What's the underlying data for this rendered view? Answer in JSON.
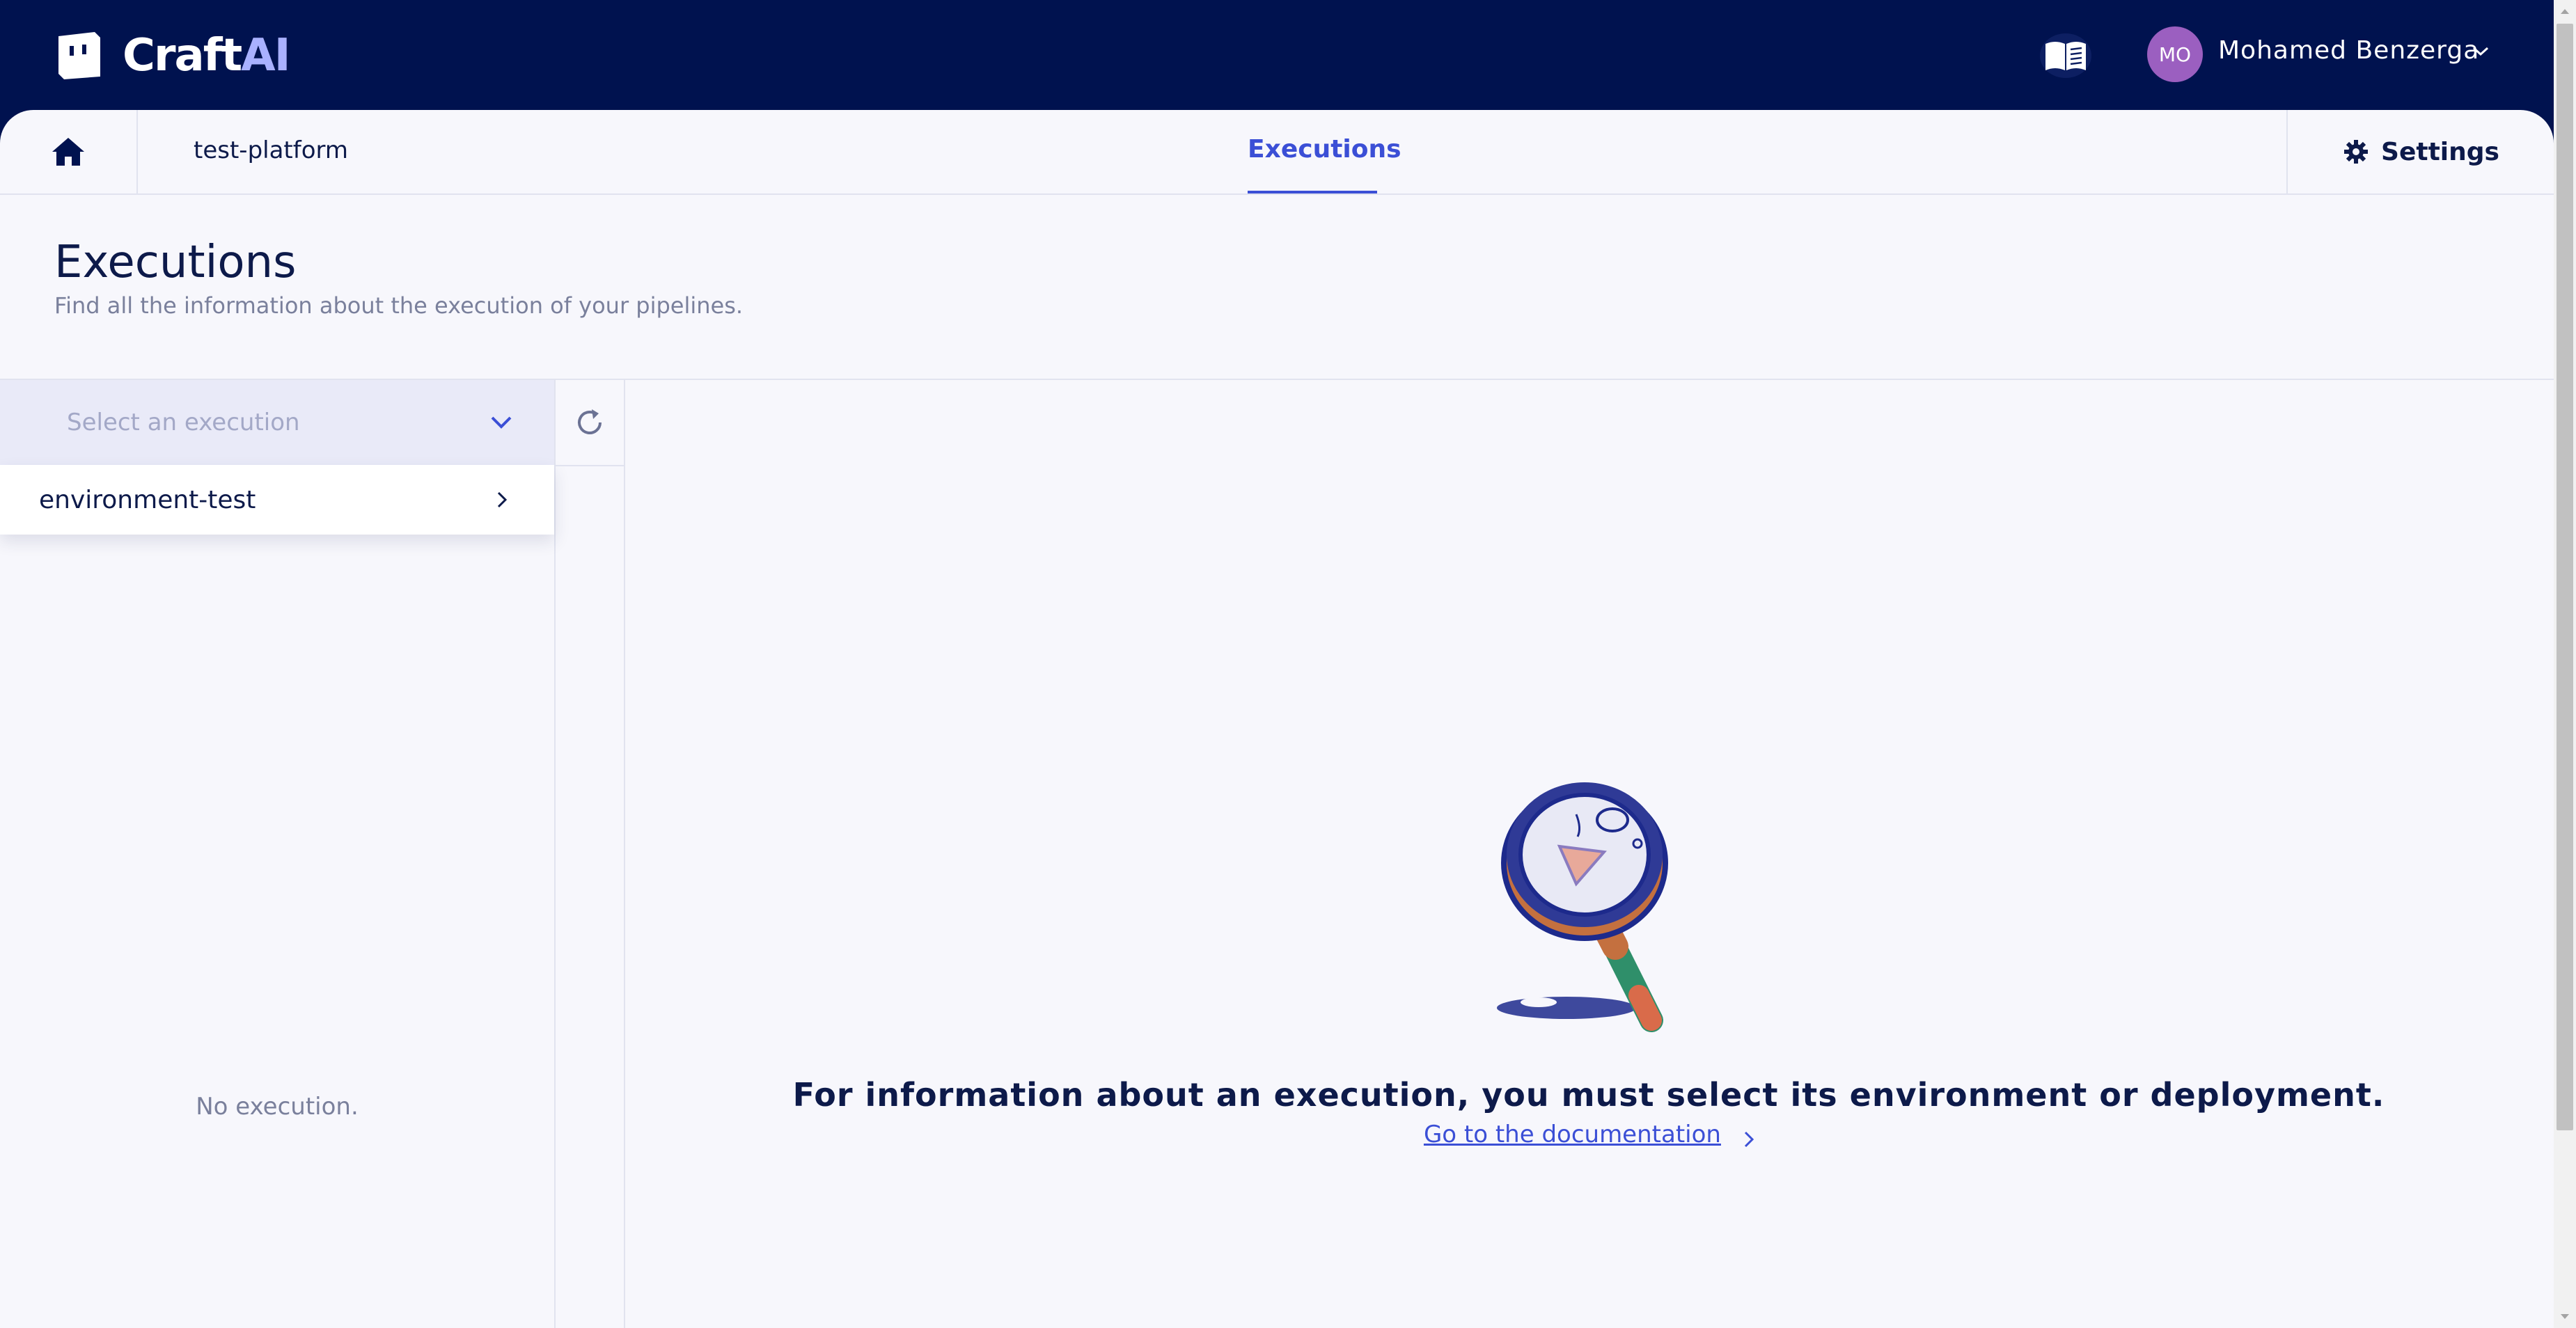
{
  "header": {
    "brand": {
      "name": "Craft",
      "suffix": "AI"
    },
    "user": {
      "initials": "MO",
      "name": "Mohamed Benzerga"
    },
    "icons": {
      "docs": "book-open-icon",
      "user_menu": "chevron-down-icon"
    }
  },
  "nav": {
    "project": "test-platform",
    "active_tab": "Executions",
    "settings_label": "Settings",
    "icons": {
      "home": "home-icon",
      "settings": "gear-icon"
    }
  },
  "page": {
    "title": "Executions",
    "subtitle": "Find all the information about the execution of your pipelines."
  },
  "execution_panel": {
    "select_placeholder": "Select an execution",
    "dropdown_items": [
      {
        "label": "environment-test"
      }
    ],
    "empty_text": "No execution."
  },
  "empty_state": {
    "message": "For information about an execution, you must select its environment or deployment.",
    "link_label": "Go to the documentation",
    "illustration": "magnifying-glass-illustration"
  },
  "colors": {
    "header_bg": "#00124f",
    "accent": "#3b4fd6",
    "page_bg": "#f7f7fc",
    "avatar_bg": "#9b5fc0",
    "select_bg": "#e9eaf8"
  }
}
